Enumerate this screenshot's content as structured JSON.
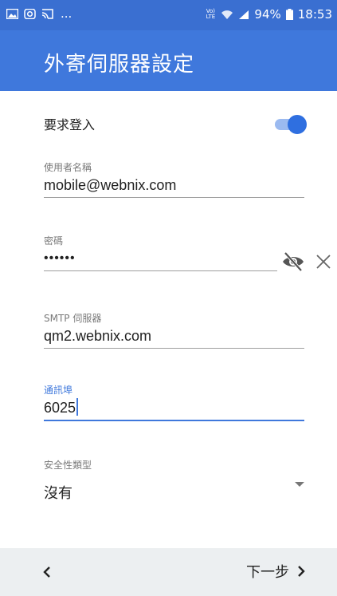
{
  "status_bar": {
    "dots": "...",
    "network_label": "Vo) LTE",
    "battery_percent": "94%",
    "time": "18:53",
    "icons": [
      "gallery-icon",
      "instagram-icon",
      "cast-icon",
      "wifi-icon",
      "signal-icon",
      "battery-icon"
    ]
  },
  "app_bar": {
    "title": "外寄伺服器設定"
  },
  "require_login": {
    "label": "要求登入",
    "enabled": true
  },
  "username": {
    "label": "使用者名稱",
    "value": "mobile@webnix.com"
  },
  "password": {
    "label": "密碼",
    "value": "••••••",
    "icons": [
      "eye-off-icon",
      "clear-icon"
    ]
  },
  "smtp_server": {
    "label": "SMTP 伺服器",
    "value": "qm2.webnix.com"
  },
  "port": {
    "label": "通訊埠",
    "value": "6025"
  },
  "security_type": {
    "label": "安全性類型",
    "value": "沒有"
  },
  "bottom_bar": {
    "next_label": "下一步"
  },
  "colors": {
    "primary": "#3f78dc",
    "status_bar": "#3a6fd1",
    "bottom_bar": "#eceff1"
  }
}
